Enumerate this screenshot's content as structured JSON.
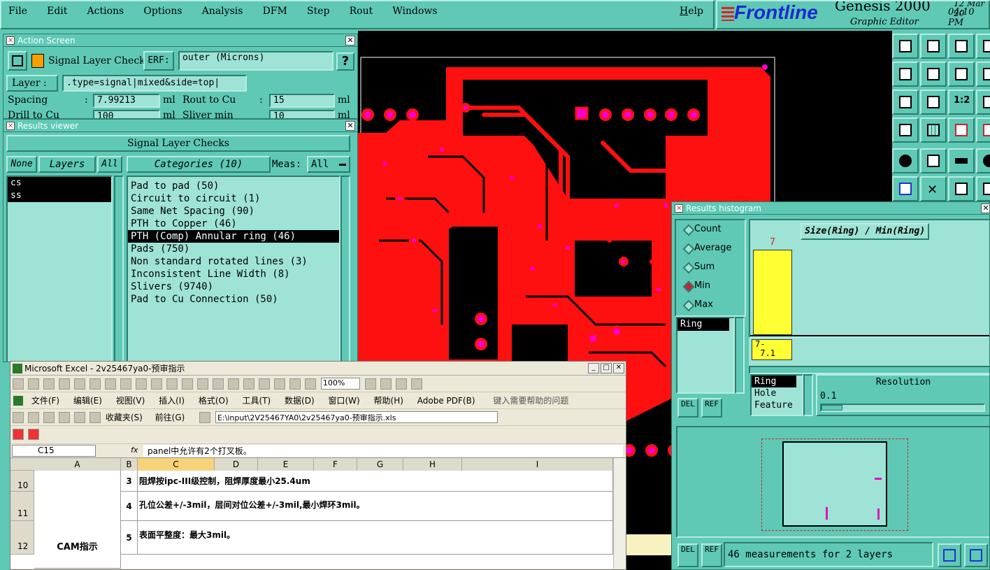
{
  "menubar": {
    "items": [
      "File",
      "Edit",
      "Actions",
      "Options",
      "Analysis",
      "DFM",
      "Step",
      "Rout",
      "Windows"
    ],
    "help": "Help"
  },
  "brand": {
    "logo": "Frontline",
    "product": "Genesis 2000",
    "subtitle": "Graphic Editor",
    "date": "12 Mar 20",
    "time": "04:10 PM"
  },
  "action_screen": {
    "title": "Action Screen",
    "checklist": "Signal Layer Checks",
    "erf_label": "ERF:",
    "erf_value": "outer (Microns)",
    "help": "?",
    "layer_label": "Layer :",
    "layer_value": ".type=signal|mixed&side=top|",
    "spacing_label": "Spacing",
    "spacing_value": "7.99213",
    "spacing_unit": "ml",
    "rout_label": "Rout to Cu",
    "rout_value": "15",
    "rout_unit": "ml",
    "drill_label": "Drill to Cu",
    "drill_value": "100",
    "drill_unit": "ml",
    "sliver_label": "Sliver min",
    "sliver_value": "10",
    "sliver_unit": "ml"
  },
  "results_viewer": {
    "title": "Results viewer",
    "header": "Signal Layer Checks",
    "none": "None",
    "layers": "Layers",
    "all": "All",
    "categories": "Categories (10)",
    "meas_label": "Meas:",
    "meas_value": "All",
    "layer_items": [
      "cs",
      "ss"
    ],
    "category_items": [
      "Pad to pad (50)",
      "Circuit to circuit (1)",
      "Same Net Spacing (90)",
      "PTH to Copper (46)",
      "PTH (Comp) Annular ring (46)",
      "Pads (750)",
      "Non standard rotated lines (3)",
      "Inconsistent Line Width (8)",
      "Slivers (9740)",
      "Pad to Cu Connection (50)"
    ],
    "selected_category": 4
  },
  "histogram": {
    "title": "Results histogram",
    "modes": [
      "Count",
      "Average",
      "Sum",
      "Min",
      "Max"
    ],
    "selected_mode": "Min",
    "plot_title": "Size(Ring) / Min(Ring)",
    "bar_label": "7",
    "bar_fill": 1.0,
    "range_label": "7-\n 7.1",
    "list_item": "Ring",
    "sort_items": [
      "Ring",
      "Hole",
      "Feature"
    ],
    "resolution_label": "Resolution",
    "resolution_value": "0.1",
    "del": "DEL",
    "ref": "REF",
    "status": "46 measurements for 2 layers"
  },
  "excel": {
    "title": "Microsoft Excel - 2v25467ya0-预审指示",
    "menu": [
      "文件(F)",
      "编辑(E)",
      "视图(V)",
      "插入(I)",
      "格式(O)",
      "工具(T)",
      "数据(D)",
      "窗口(W)",
      "帮助(H)",
      "Adobe PDF(B)"
    ],
    "help_box": "键入需要帮助的问题",
    "zoom": "100%",
    "favorites": "收藏夹(S)",
    "goto": "前往(G)",
    "path": "E:\\input\\2V25467YA0\\2v25467ya0-预审指示.xls",
    "cell_ref": "C15",
    "fx": "fx",
    "formula": "panel中允许有2个打叉板。",
    "columns": [
      "A",
      "B",
      "C",
      "D",
      "E",
      "F",
      "G",
      "H",
      "I"
    ],
    "rows": [
      {
        "num": "10",
        "b": "3",
        "c": "阻焊按ipc-III级控制，阻焊厚度最小25.4um"
      },
      {
        "num": "11",
        "b": "4",
        "c": "孔位公差+/-3mil，层间对位公差+/-3mil,最小焊环3mil。"
      },
      {
        "num": "12",
        "b": "5",
        "c": "表面平整度：最大3mil。"
      }
    ],
    "merged_a": "CAM指示"
  },
  "colors": {
    "panel": "#5fc9b5",
    "copper": "#ff1010",
    "pad": "#ff00cc",
    "board_bg": "#000000",
    "bar": "#ffff33"
  }
}
